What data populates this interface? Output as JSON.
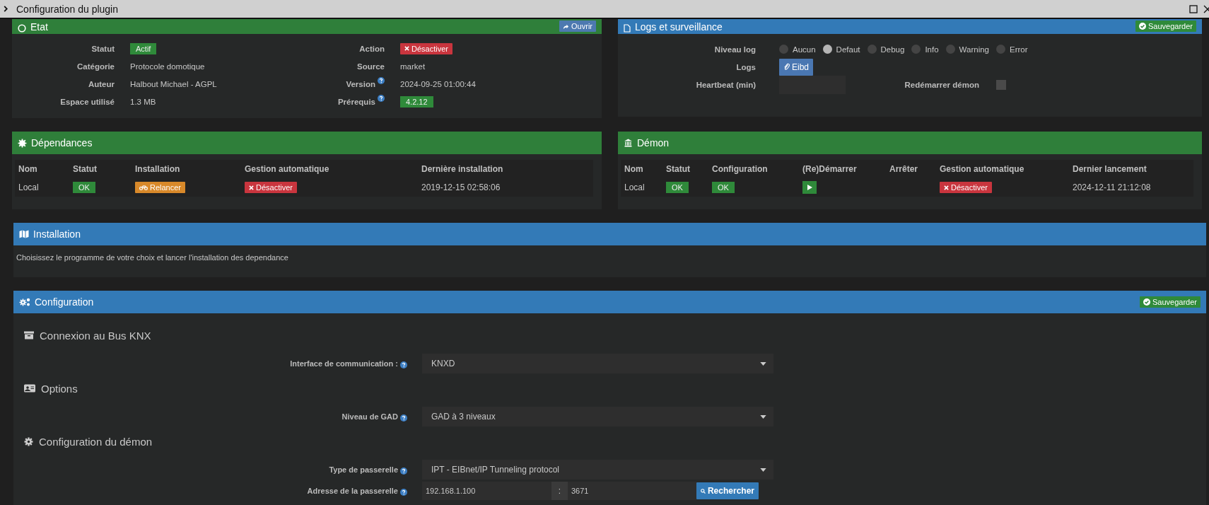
{
  "window": {
    "title": "Configuration du plugin"
  },
  "etat": {
    "title": "Etat",
    "open_button": "Ouvrir",
    "fields": [
      {
        "label": "Statut",
        "value": "Actif",
        "kind": "badge",
        "help": false
      },
      {
        "label": "Action",
        "value": "Désactiver",
        "kind": "danger-button",
        "help": false
      },
      {
        "label": "Catégorie",
        "value": "Protocole domotique",
        "kind": "text",
        "help": false
      },
      {
        "label": "Source",
        "value": "market",
        "kind": "text",
        "help": false
      },
      {
        "label": "Auteur",
        "value": "Halbout Michael - AGPL",
        "kind": "text",
        "help": false
      },
      {
        "label": "Version",
        "value": "2024-09-25 01:00:44",
        "kind": "text",
        "help": true
      },
      {
        "label": "Espace utilisé",
        "value": "1.3 MB",
        "kind": "text",
        "help": false
      },
      {
        "label": "Prérequis",
        "value": "4.2.12",
        "kind": "badge",
        "help": true
      }
    ]
  },
  "logs": {
    "title": "Logs et surveillance",
    "save_button": "Sauvegarder",
    "level_label": "Niveau log",
    "levels": [
      {
        "label": "Aucun",
        "selected": false
      },
      {
        "label": "Defaut",
        "selected": true
      },
      {
        "label": "Debug",
        "selected": false
      },
      {
        "label": "Info",
        "selected": false
      },
      {
        "label": "Warning",
        "selected": false
      },
      {
        "label": "Error",
        "selected": false
      }
    ],
    "logs_label": "Logs",
    "logs_button": "Eibd",
    "heartbeat_label": "Heartbeat (min)",
    "restart_label": "Redémarrer démon",
    "restart_checked": false
  },
  "dependances": {
    "title": "Dépendances",
    "columns": [
      "Nom",
      "Statut",
      "Installation",
      "Gestion automatique",
      "Dernière installation"
    ],
    "rows": [
      {
        "cells": [
          {
            "kind": "text",
            "text": "Local"
          },
          {
            "kind": "ok",
            "text": "OK"
          },
          {
            "kind": "warning-button",
            "text": "Relancer"
          },
          {
            "kind": "danger-button",
            "text": "Désactiver"
          },
          {
            "kind": "text",
            "text": "2019-12-15 02:58:06"
          }
        ]
      }
    ]
  },
  "demon": {
    "title": "Démon",
    "columns": [
      "Nom",
      "Statut",
      "Configuration",
      "(Re)Démarrer",
      "Arrêter",
      "Gestion automatique",
      "Dernier lancement"
    ],
    "rows": [
      {
        "cells": [
          {
            "kind": "text",
            "text": "Local"
          },
          {
            "kind": "ok",
            "text": "OK"
          },
          {
            "kind": "ok",
            "text": "OK"
          },
          {
            "kind": "play-button"
          },
          {
            "kind": "empty"
          },
          {
            "kind": "danger-button",
            "text": "Désactiver"
          },
          {
            "kind": "text",
            "text": "2024-12-11 21:12:08"
          }
        ]
      }
    ]
  },
  "installation": {
    "title": "Installation",
    "text": "Choisissez le programme de votre choix et lancer l'installation des dependance"
  },
  "configuration": {
    "title": "Configuration",
    "save_button": "Sauvegarder",
    "sections": [
      {
        "title": "Connexion au Bus KNX",
        "fields": [
          {
            "label": "Interface de communication :",
            "help": true,
            "kind": "select",
            "value": "KNXD"
          }
        ]
      },
      {
        "title": "Options",
        "fields": [
          {
            "label": "Niveau de GAD",
            "help": true,
            "kind": "select",
            "value": "GAD à 3 niveaux"
          }
        ]
      },
      {
        "title": "Configuration du démon",
        "fields": [
          {
            "label": "Type de passerelle",
            "help": true,
            "kind": "select",
            "value": "IPT - EIBnet/IP Tunneling protocol"
          },
          {
            "label": "Adresse de la passerelle",
            "help": true,
            "kind": "address",
            "host": "192.168.1.100",
            "separator": ":",
            "port": "3671",
            "button": "Rechercher"
          }
        ]
      }
    ]
  }
}
